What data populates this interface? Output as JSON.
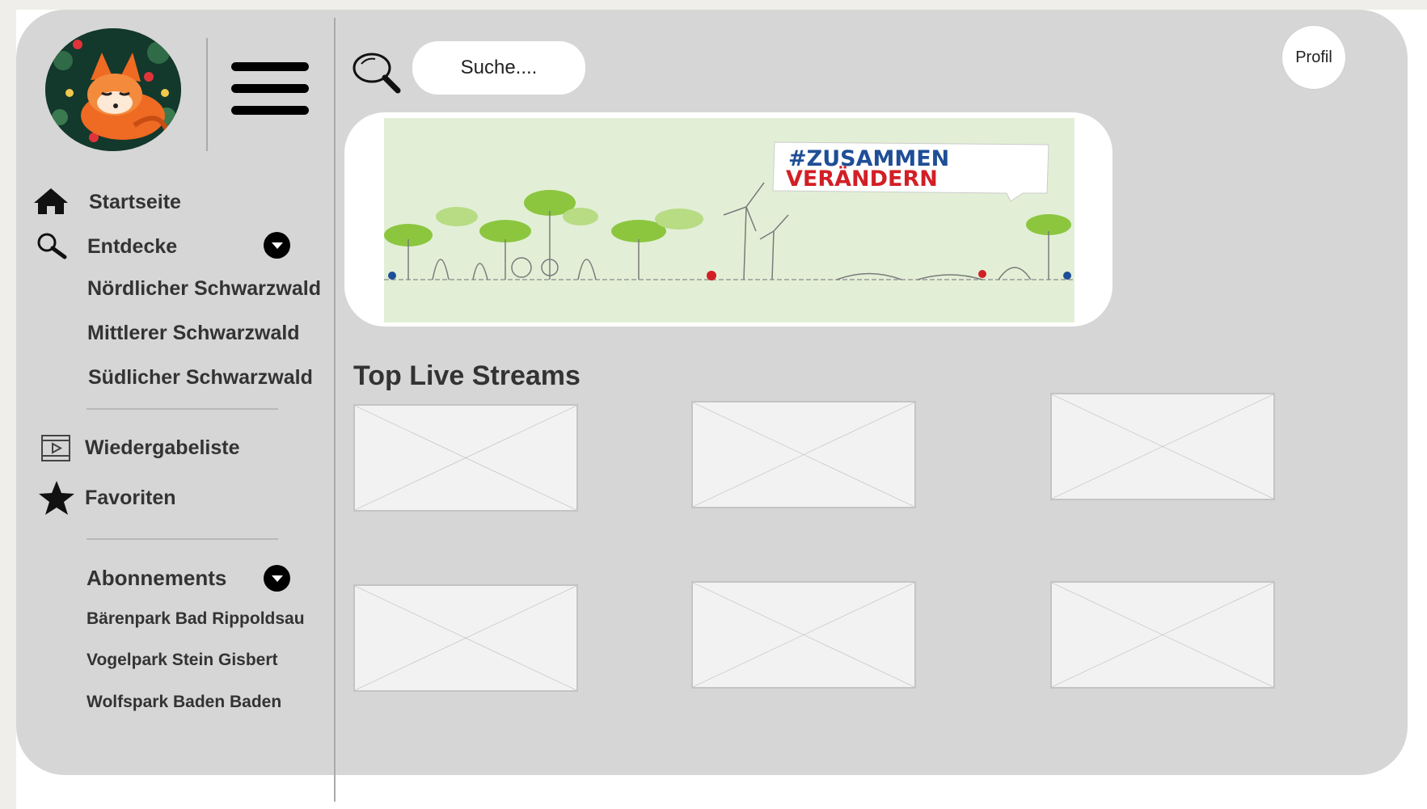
{
  "search": {
    "placeholder": "Suche...."
  },
  "header": {
    "profile_label": "Profil"
  },
  "sidebar": {
    "items": [
      {
        "label": "Startseite",
        "icon": "home-icon"
      },
      {
        "label": "Entdecke",
        "icon": "search-icon"
      },
      {
        "label": "Wiedergabeliste",
        "icon": "playlist-icon"
      },
      {
        "label": "Favoriten",
        "icon": "star-icon"
      }
    ],
    "discover_sub": [
      "Nördlicher Schwarzwald",
      "Mittlerer Schwarzwald",
      "Südlicher Schwarzwald"
    ],
    "subscriptions": {
      "label": "Abonnements",
      "items": [
        "Bärenpark Bad Rippoldsau",
        "Vogelpark Stein Gisbert",
        "Wolfspark Baden Baden"
      ]
    }
  },
  "banner": {
    "line1": "#ZUSAMMEN",
    "line2": "VERÄNDERN"
  },
  "main": {
    "section_title": "Top Live Streams"
  },
  "colors": {
    "frame_bg": "#d6d6d6",
    "banner_green": "#e2efd6",
    "hashtag_blue": "#1f4e96",
    "slogan_red": "#d21f26",
    "tree_green": "#8cc63f"
  }
}
